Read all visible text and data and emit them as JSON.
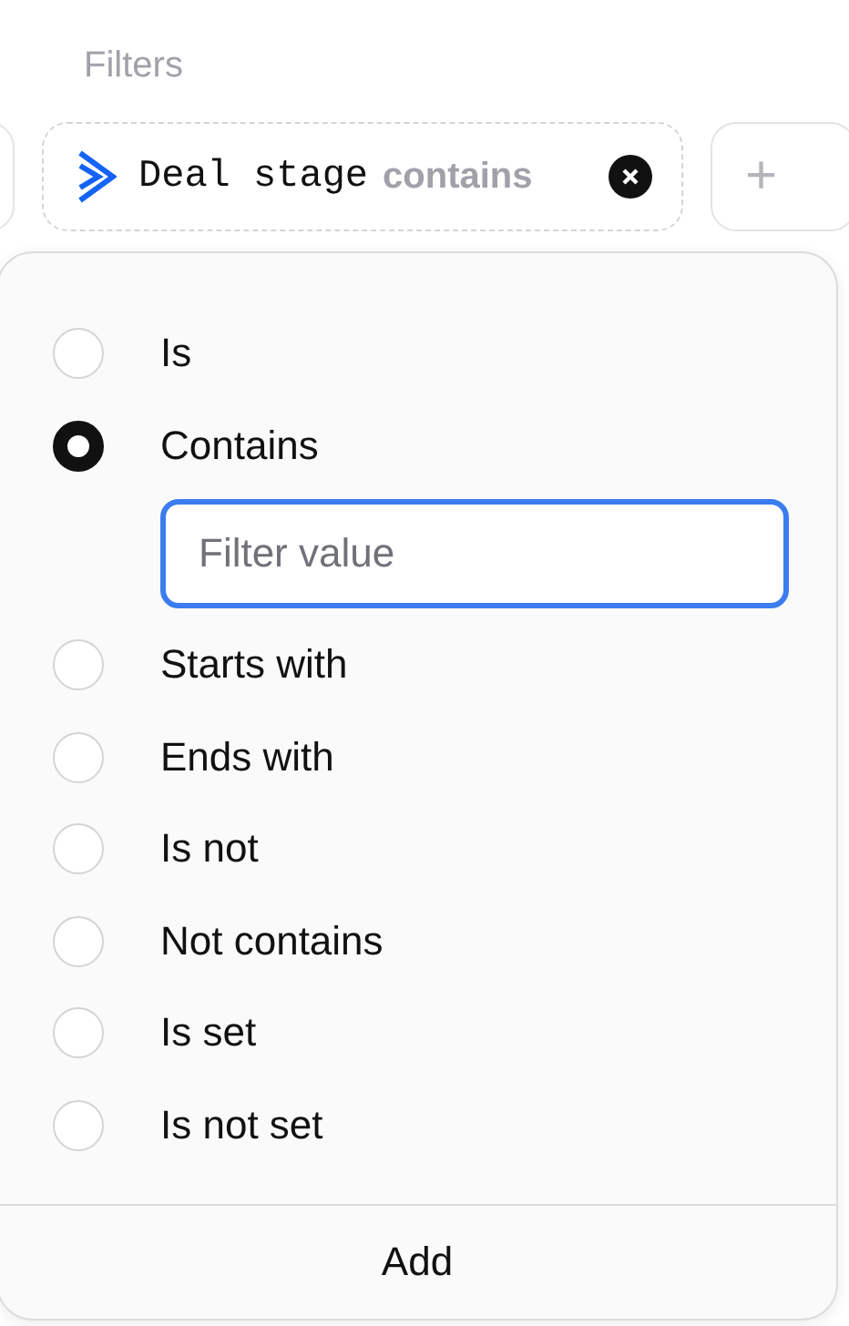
{
  "filters_label": "Filters",
  "filter_chip": {
    "field": "Deal stage",
    "operator": "contains"
  },
  "add_filter": {
    "symbol": "+"
  },
  "operators": [
    {
      "label": "Is",
      "selected": false
    },
    {
      "label": "Contains",
      "selected": true,
      "input": {
        "placeholder": "Filter value"
      }
    },
    {
      "label": "Starts with",
      "selected": false
    },
    {
      "label": "Ends with",
      "selected": false
    },
    {
      "label": "Is not",
      "selected": false
    },
    {
      "label": "Not contains",
      "selected": false
    },
    {
      "label": "Is set",
      "selected": false
    },
    {
      "label": "Is not set",
      "selected": false
    }
  ],
  "footer_button": "Add"
}
